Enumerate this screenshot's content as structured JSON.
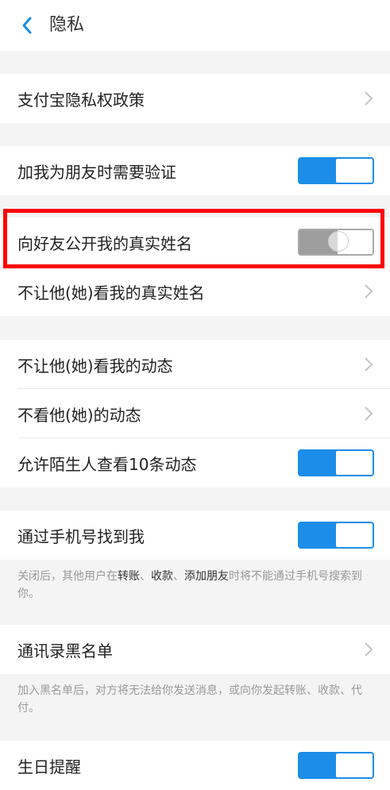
{
  "header": {
    "title": "隐私"
  },
  "rows": {
    "policy": "支付宝隐私权政策",
    "verify": "加我为朋友时需要验证",
    "real_name": "向好友公开我的真实姓名",
    "hide_real_name": "不让他(她)看我的真实姓名",
    "hide_moments": "不让他(她)看我的动态",
    "not_view": "不看他(她)的动态",
    "stranger_view": "允许陌生人查看10条动态",
    "phone_find": "通过手机号找到我",
    "blacklist": "通讯录黑名单",
    "birthday": "生日提醒"
  },
  "notes": {
    "phone": {
      "p1": "关闭后，其他用户在",
      "k1": "转账",
      "p2": "、",
      "k2": "收款",
      "p3": "、",
      "k3": "添加朋友",
      "p4": "时将不能通过手机号搜索到你。"
    },
    "blacklist": "加入黑名单后，对方将无法给你发送消息，或向你发起转账、收款、代付。"
  },
  "toggles": {
    "verify": "on",
    "real_name": "off",
    "stranger_view": "on",
    "phone_find": "on",
    "birthday": "on"
  },
  "colors": {
    "accent": "#1c8de8",
    "highlight": "#ff0000"
  },
  "icons": {
    "back": "chevron-left-icon",
    "row_arrow": "chevron-right-icon"
  }
}
